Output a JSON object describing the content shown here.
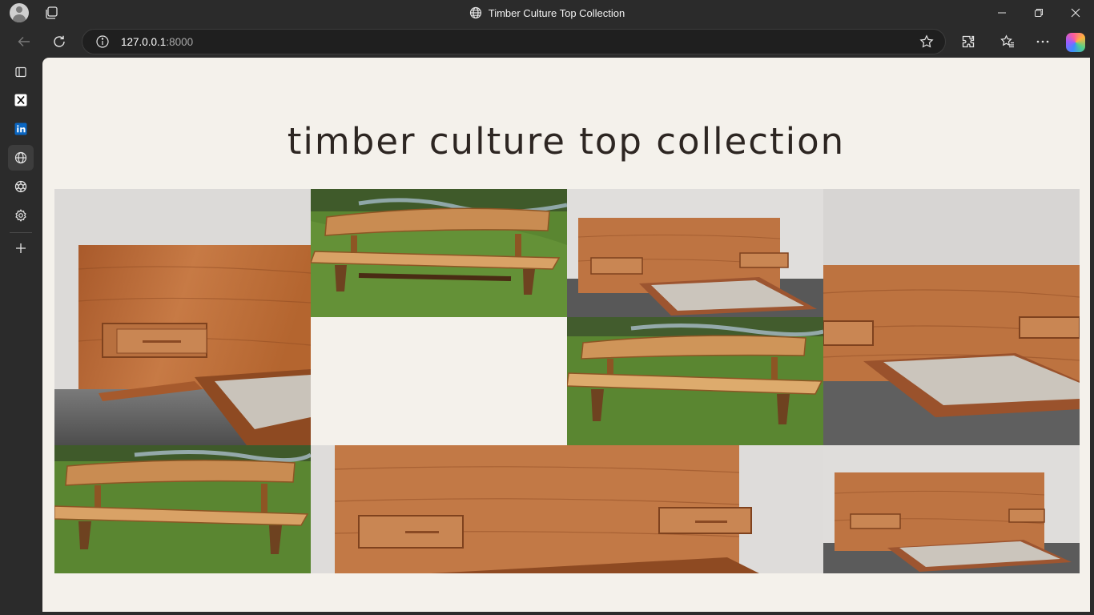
{
  "browser": {
    "tab_title": "Timber Culture Top Collection",
    "url_host": "127.0.0.1",
    "url_port": ":8000",
    "icons": {
      "profile": "avatar-icon",
      "workspaces": "workspaces-icon",
      "tab_favicon": "globe-icon",
      "minimize": "minimize-icon",
      "restore": "restore-icon",
      "close": "close-icon",
      "back": "back-arrow-icon",
      "refresh": "refresh-icon",
      "site_info": "info-icon",
      "favorite": "star-icon",
      "extensions": "extensions-icon",
      "favorites": "favorites-icon",
      "more": "more-icon",
      "copilot": "copilot-icon"
    }
  },
  "sidebar": {
    "items": [
      {
        "name": "sidebar-toggle-icon"
      },
      {
        "name": "x-twitter-icon"
      },
      {
        "name": "linkedin-icon"
      },
      {
        "name": "globe-icon",
        "active": true
      },
      {
        "name": "openai-icon"
      },
      {
        "name": "settings-icon"
      },
      {
        "name": "add-icon"
      }
    ]
  },
  "page": {
    "heading": "timber culture top collection",
    "background": "#f4f1eb",
    "gallery": [
      {
        "subject": "bed-with-headboard"
      },
      {
        "subject": "wooden-bench-on-grass"
      },
      {
        "subject": "bed-with-headboard"
      },
      {
        "subject": "bed-with-headboard"
      },
      {
        "subject": "wooden-bench-on-grass"
      },
      {
        "subject": "wooden-bench-on-grass"
      },
      {
        "subject": "bed-headboard-closeup"
      },
      {
        "subject": "bed-with-headboard"
      }
    ]
  },
  "colors": {
    "chrome": "#2b2b2b",
    "wood": "#b8693a",
    "grass": "#5d8a33",
    "wall": "#d6d4d2"
  }
}
